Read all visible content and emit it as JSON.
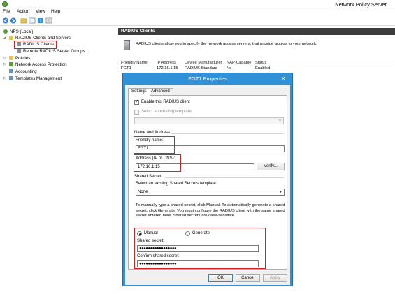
{
  "window": {
    "title": "Network Policy Server"
  },
  "menu": [
    "File",
    "Action",
    "View",
    "Help"
  ],
  "toolbar": [
    "back-arrow-icon",
    "forward-arrow-icon",
    "folder-up-icon",
    "console-tree-icon",
    "help-icon",
    "properties-icon"
  ],
  "tree": {
    "root": "NPS (Local)",
    "radius_group": "RADIUS Clients and Servers",
    "radius_clients": "RADIUS Clients",
    "remote_groups": "Remote RADIUS Server Groups",
    "policies": "Policies",
    "nap": "Network Access Protection",
    "accounting": "Accounting",
    "templates": "Templates Management"
  },
  "content": {
    "header": "RADIUS Clients",
    "description": "RADIUS clients allow you to specify the network access servers, that provide access to your network.",
    "columns": [
      "Friendly Name",
      "IP Address",
      "Device Manufacturer",
      "NAP-Capable",
      "Status"
    ],
    "rows": [
      [
        "FGT1",
        "172.16.1.15",
        "RADIUS Standard",
        "No",
        "Enabled"
      ]
    ]
  },
  "dialog": {
    "title": "FGT1 Properties",
    "close": "✕",
    "tabs": [
      "Settings",
      "Advanced"
    ],
    "enable_client": "Enable this RADIUS client",
    "select_template": "Select an existing template:",
    "name_address_heading": "Name and Address",
    "friendly_name_label": "Friendly name:",
    "friendly_name_value": "FGT1",
    "address_label": "Address (IP or DNS):",
    "address_value": "172.16.1.15",
    "verify_button": "Verify...",
    "shared_secret_heading": "Shared Secret",
    "shared_template_label": "Select an existing Shared Secrets template:",
    "shared_template_value": "None",
    "instructions": "To manually type a shared secret, click Manual. To automatically generate a shared secret, click Generate. You must configure the RADIUS client with the same shared secret entered here. Shared secrets are case-sensitive.",
    "manual_label": "Manual",
    "generate_label": "Generate",
    "shared_secret_label": "Shared secret:",
    "shared_secret_value": "●●●●●●●●●●●●●●●●●",
    "confirm_secret_label": "Confirm shared secret:",
    "confirm_secret_value": "●●●●●●●●●●●●●●●●●",
    "ok": "OK",
    "cancel": "Cancel",
    "apply": "Apply"
  },
  "colors": {
    "accent": "#2f91d8",
    "highlight": "#d81e1e",
    "header": "#3c3c3c"
  }
}
